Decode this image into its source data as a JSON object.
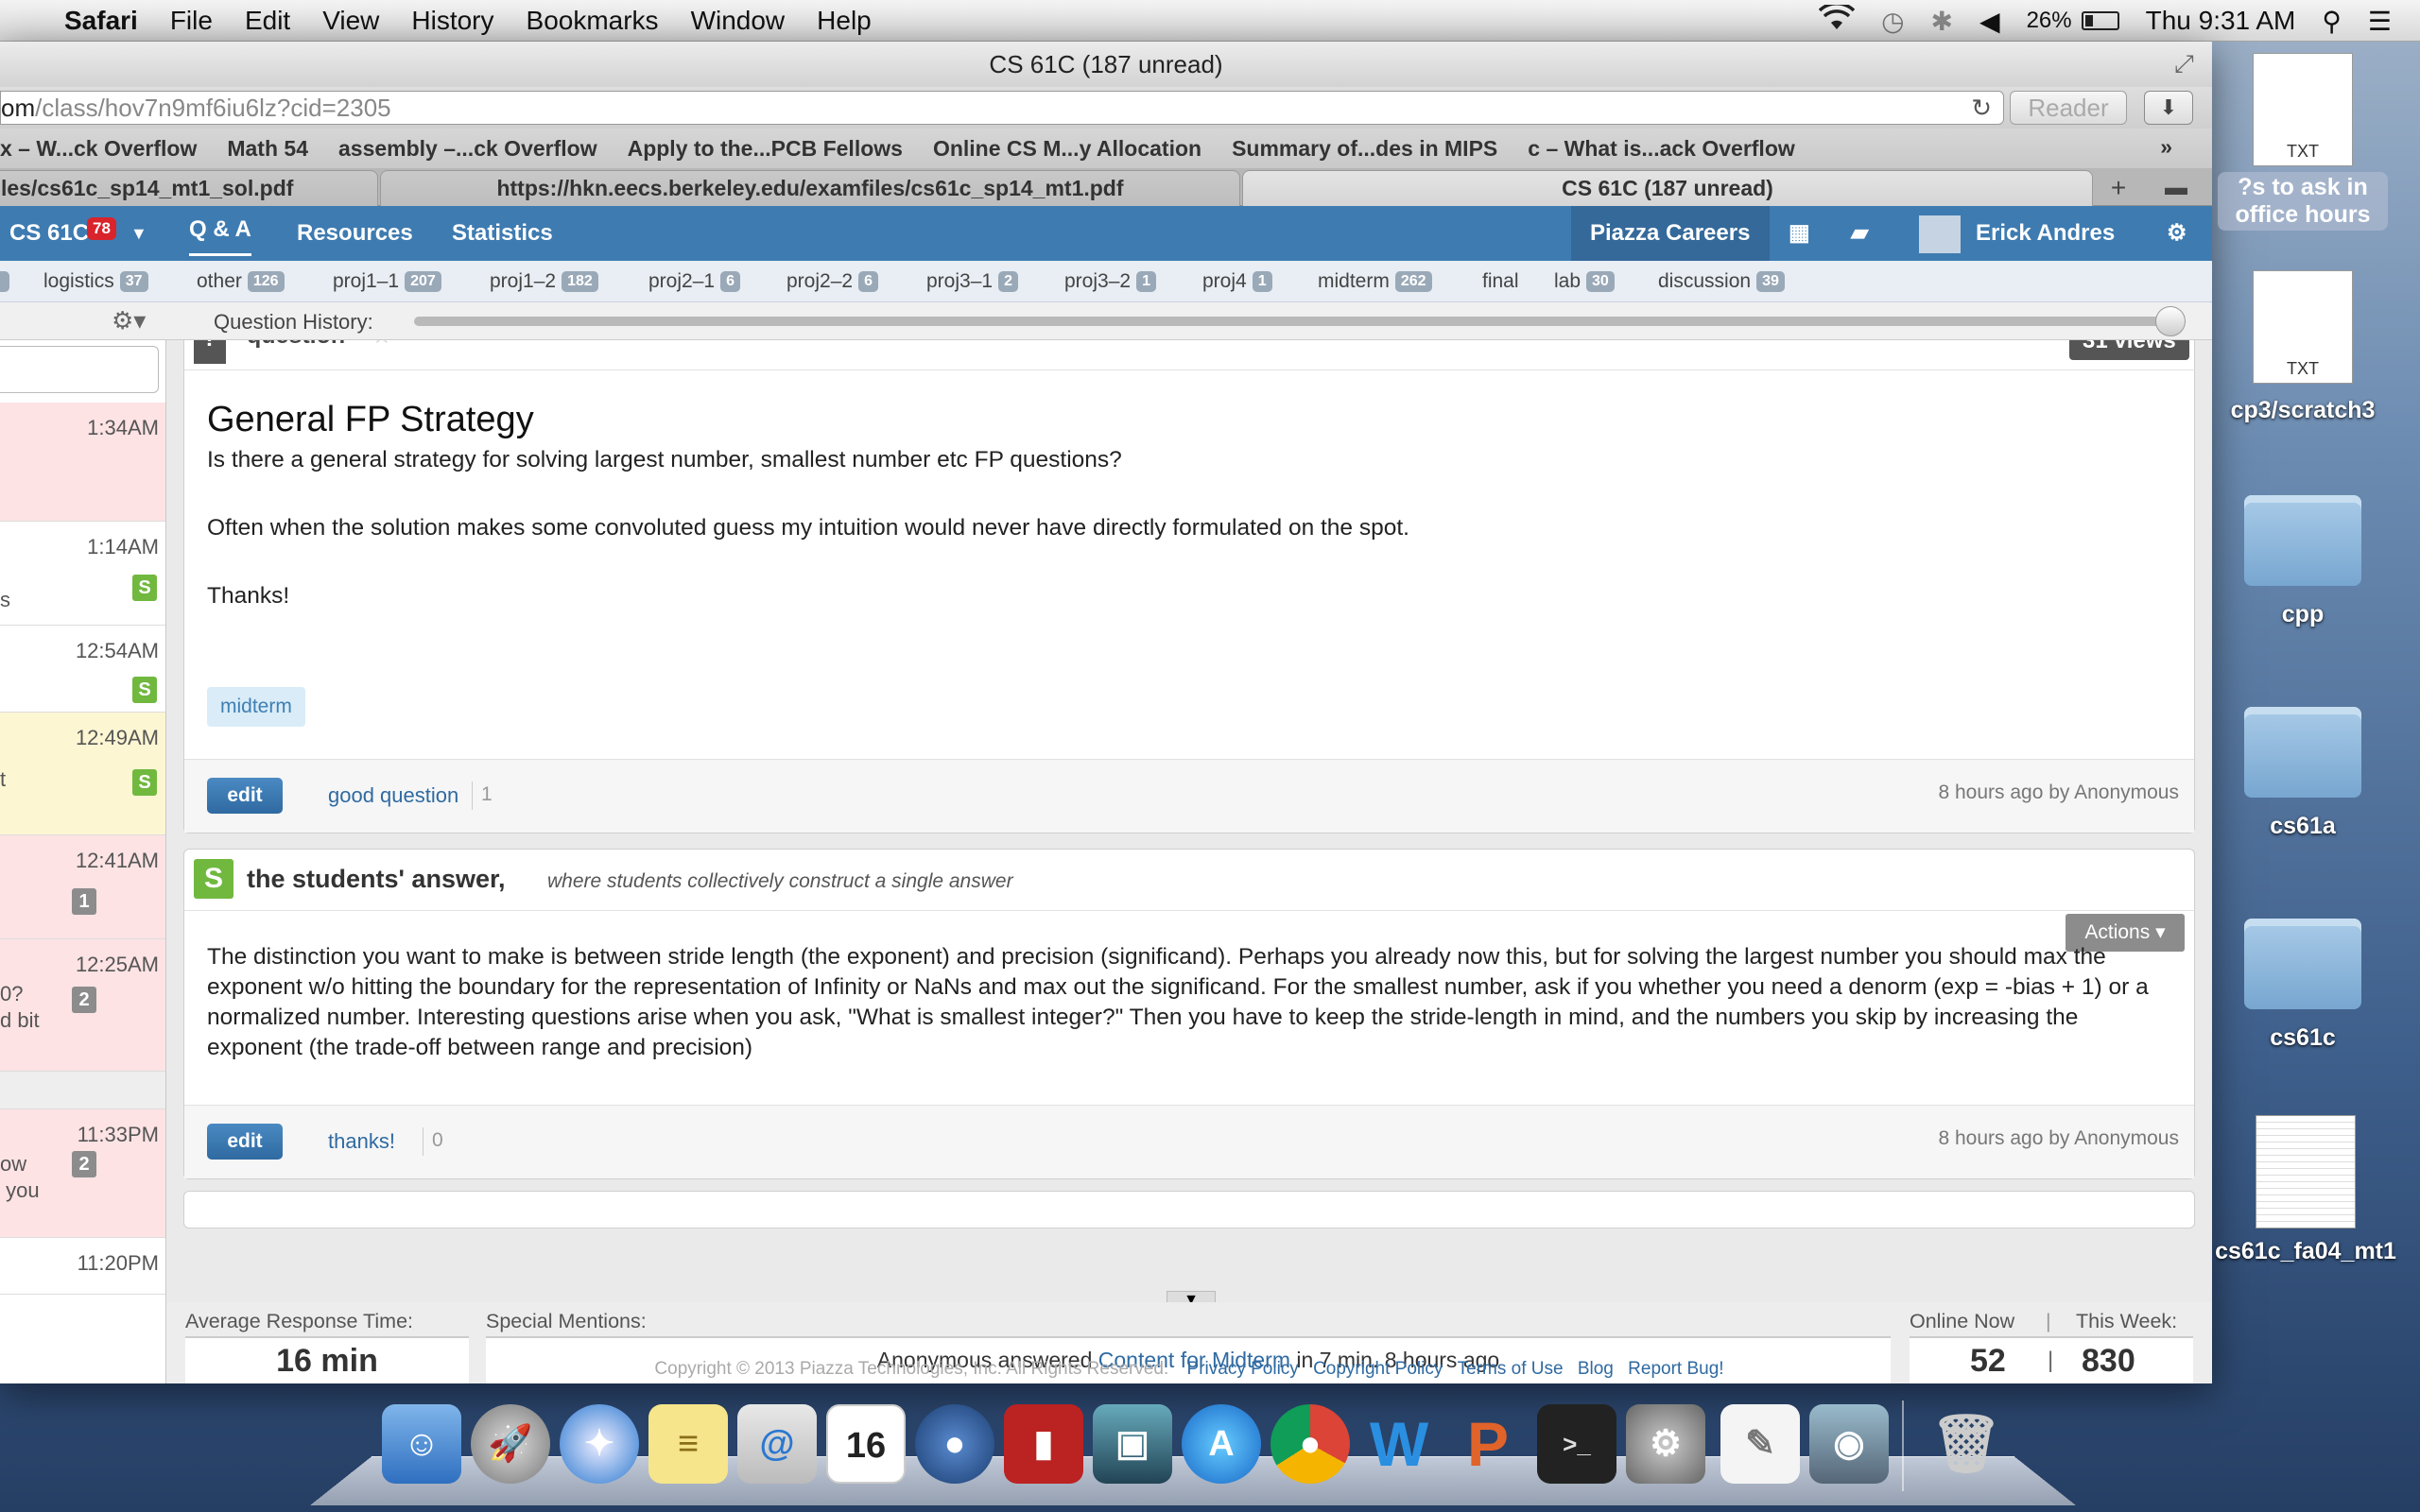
{
  "menubar": {
    "app": "Safari",
    "menus": [
      "File",
      "Edit",
      "View",
      "History",
      "Bookmarks",
      "Window",
      "Help"
    ],
    "battery": "26%",
    "clock": "Thu 9:31 AM"
  },
  "window": {
    "title": "CS 61C (187 unread)",
    "url_dim": "om",
    "url_main": "/class/hov7n9mf6iu6lz?cid=2305",
    "reader": "Reader"
  },
  "bookmarks": [
    "x – W...ck Overflow",
    "Math 54",
    "assembly –...ck Overflow",
    "Apply to the...PCB Fellows",
    "Online CS M...y Allocation",
    "Summary of...des in MIPS",
    "c – What is...ack Overflow"
  ],
  "tabs": [
    "les/cs61c_sp14_mt1_sol.pdf",
    "https://hkn.eecs.berkeley.edu/examfiles/cs61c_sp14_mt1.pdf",
    "CS 61C (187 unread)"
  ],
  "piazza": {
    "course": "CS 61C",
    "course_badge": "78",
    "nav": [
      "Q & A",
      "Resources",
      "Statistics"
    ],
    "careers": "Piazza Careers",
    "user": "Erick Andres"
  },
  "filters": [
    {
      "label": "logistics",
      "count": "37"
    },
    {
      "label": "other",
      "count": "126"
    },
    {
      "label": "proj1–1",
      "count": "207"
    },
    {
      "label": "proj1–2",
      "count": "182"
    },
    {
      "label": "proj2–1",
      "count": "6"
    },
    {
      "label": "proj2–2",
      "count": "6"
    },
    {
      "label": "proj3–1",
      "count": "2"
    },
    {
      "label": "proj3–2",
      "count": "1"
    },
    {
      "label": "proj4",
      "count": "1"
    },
    {
      "label": "midterm",
      "count": "262"
    },
    {
      "label": "final",
      "count": ""
    },
    {
      "label": "lab",
      "count": "30"
    },
    {
      "label": "discussion",
      "count": "39"
    }
  ],
  "history_label": "Question History:",
  "feed": [
    {
      "time": "1:34AM",
      "badge": "",
      "text": ""
    },
    {
      "time": "1:14AM",
      "badge": "S",
      "text": "s"
    },
    {
      "time": "12:54AM",
      "badge": "S",
      "text": ""
    },
    {
      "time": "12:49AM",
      "badge": "S",
      "text": "t"
    },
    {
      "time": "12:41AM",
      "badge": "1",
      "text": ""
    },
    {
      "time": "12:25AM",
      "badge": "2",
      "text": "0?\nd bit"
    },
    {
      "time": "11:33PM",
      "badge": "2",
      "text": "ow\n you"
    },
    {
      "time": "11:20PM",
      "badge": "",
      "text": ""
    }
  ],
  "question": {
    "type_label": "question",
    "views": "31 views",
    "title": "General FP Strategy",
    "paragraphs": [
      "Is there a general strategy for solving largest number, smallest number etc FP questions?",
      "Often when the solution makes some convoluted guess my intuition would never have directly formulated on the spot.",
      "Thanks!"
    ],
    "tag": "midterm",
    "edit": "edit",
    "good_question": "good question",
    "good_count": "1",
    "meta": "8 hours ago by Anonymous"
  },
  "answer": {
    "header": "the students' answer,",
    "subheader": "where students collectively construct a single answer",
    "actions": "Actions",
    "body": "The distinction you want to make is between stride length (the exponent) and precision (significand). Perhaps you already now this, but for solving the largest number you should max the exponent w/o hitting the boundary for the representation of Infinity or NaNs and max out the significand. For the smallest number, ask if you whether you need a denorm (exp = -bias + 1) or a normalized number. Interesting questions arise when you ask, \"What is smallest integer?\" Then you have to keep the stride-length in mind, and the numbers you skip by increasing the exponent (the trade-off between range and precision)",
    "edit": "edit",
    "thanks": "thanks!",
    "thanks_count": "0",
    "meta": "8 hours ago by Anonymous"
  },
  "stats": {
    "avg_label": "Average Response Time:",
    "avg_value": "16 min",
    "mentions_label": "Special Mentions:",
    "mention_prefix": "Anonymous answered ",
    "mention_link": "Content for Midterm",
    "mention_suffix": " in 7 min. 8 hours ago",
    "online_label": "Online Now",
    "week_label": "This Week:",
    "online_value": "52",
    "week_value": "830"
  },
  "footer": {
    "copyright": "Copyright © 2013 Piazza Technologies, Inc. All Rights Reserved.",
    "links": [
      "Privacy Policy",
      "Copyright Policy",
      "Terms of Use",
      "Blog",
      "Report Bug!"
    ]
  },
  "desktop_icons": [
    {
      "label": "?s to ask in office hours",
      "kind": "TXT"
    },
    {
      "label": "cp3/scratch3",
      "kind": "TXT"
    },
    {
      "label": "cpp",
      "kind": "folder"
    },
    {
      "label": "cs61a",
      "kind": "folder"
    },
    {
      "label": "cs61c",
      "kind": "folder"
    },
    {
      "label": "cs61c_fa04_mt1",
      "kind": "doc"
    }
  ],
  "colors": {
    "piazza_blue": "#3e7bb1",
    "students_green": "#71b83f",
    "link": "#2f6aa1"
  }
}
